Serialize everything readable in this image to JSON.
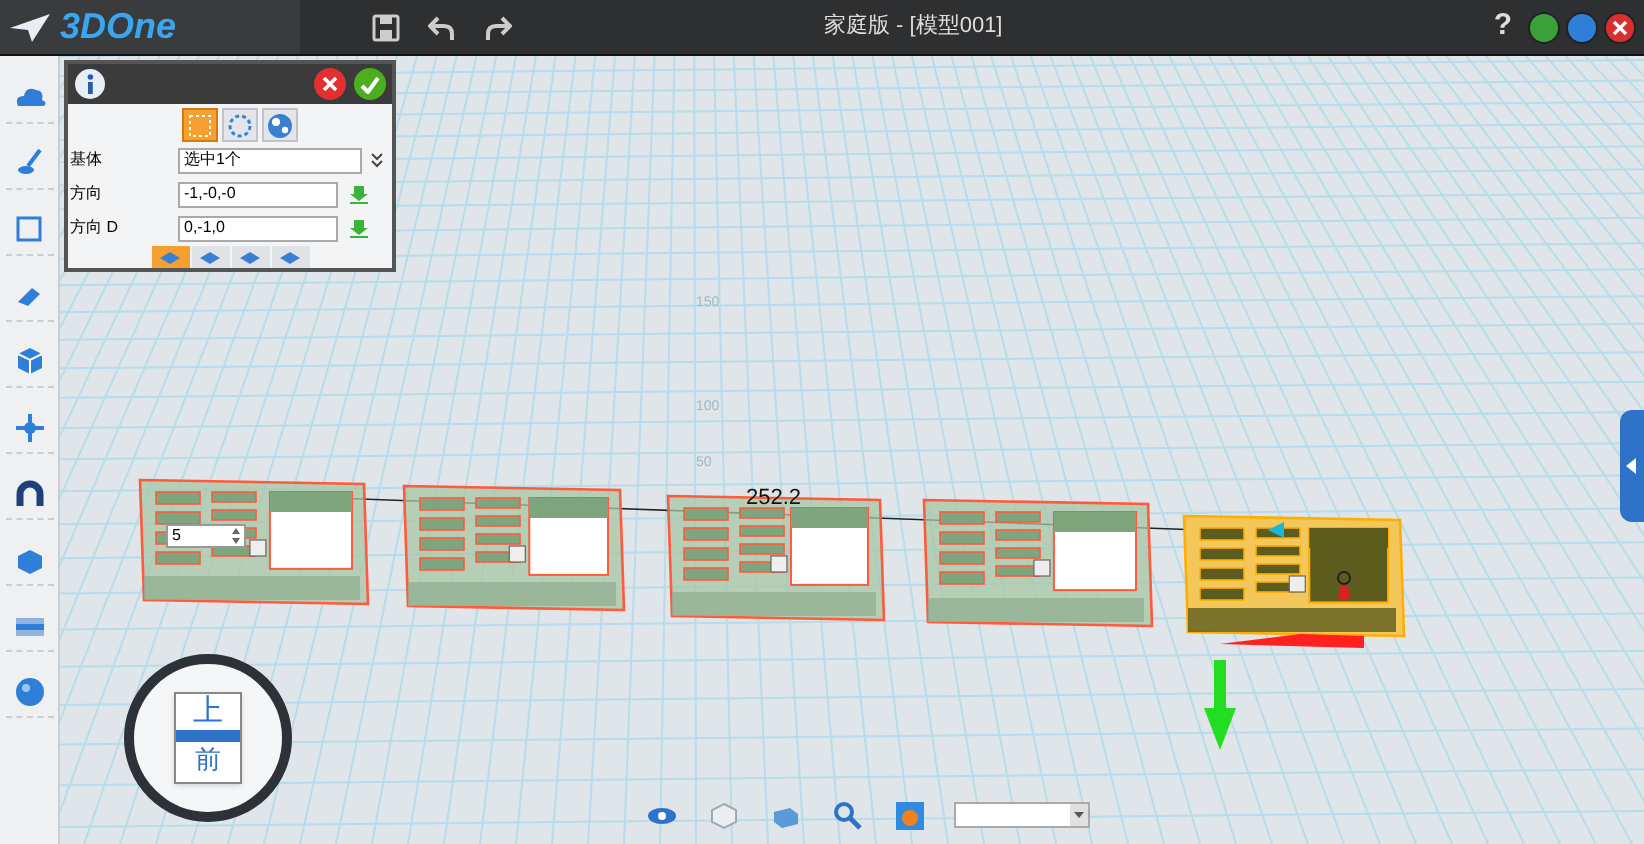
{
  "app": {
    "logo": "3DOne",
    "title": "家庭版 - [模型001]",
    "help": "?"
  },
  "panel": {
    "tabs": [
      {
        "selected": true
      },
      {
        "selected": false
      },
      {
        "selected": false
      }
    ],
    "fields": [
      {
        "label": "基体",
        "value": "选中1个",
        "kind": "select"
      },
      {
        "label": "方向",
        "value": "-1,-0,-0",
        "kind": "vector"
      },
      {
        "label": "方向 D",
        "value": "0,-1,0",
        "kind": "vector"
      }
    ],
    "bottom_tabs": [
      {
        "selected": true
      },
      {
        "selected": false
      },
      {
        "selected": false
      },
      {
        "selected": false
      }
    ]
  },
  "viewport": {
    "grid_labels": [
      "150",
      "100",
      "50"
    ],
    "dimension": "252.2",
    "count_input": "5",
    "models": [
      {
        "selected": false
      },
      {
        "selected": false
      },
      {
        "selected": false
      },
      {
        "selected": false
      },
      {
        "selected": true
      }
    ]
  },
  "nav_cube": {
    "top": "上",
    "front": "前"
  }
}
